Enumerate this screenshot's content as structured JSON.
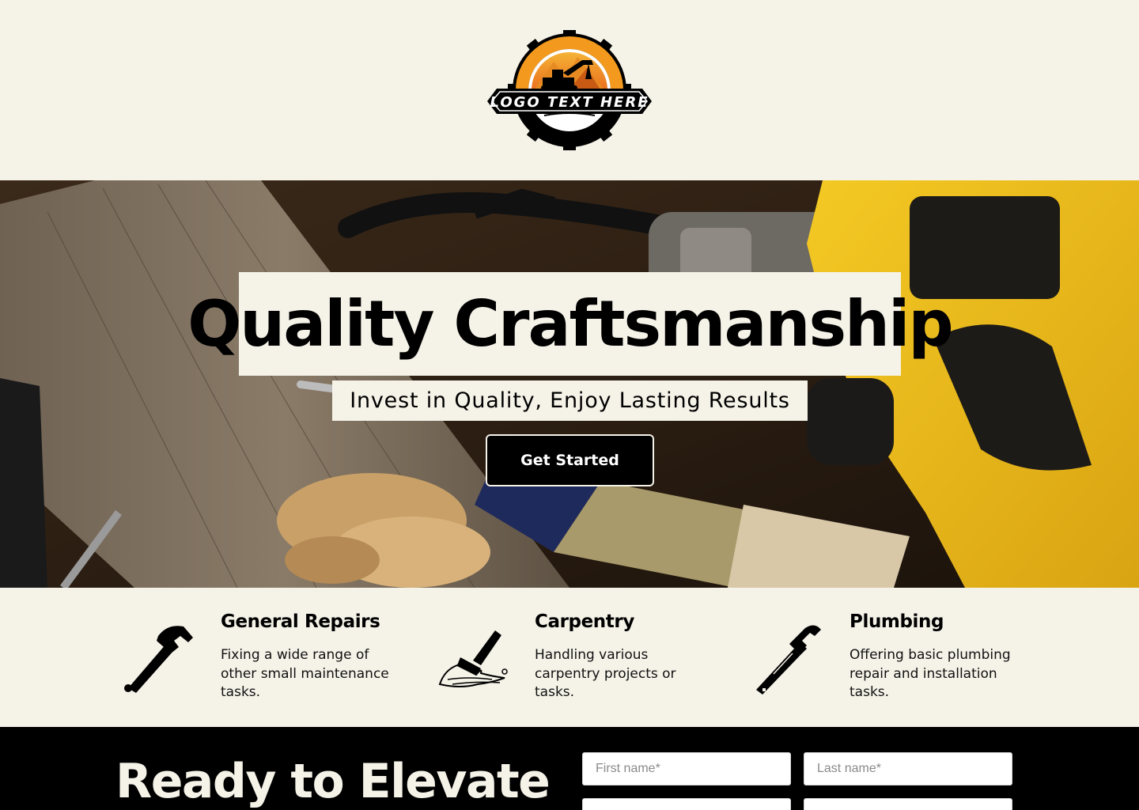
{
  "header": {
    "logo_text": "LOGO TEXT HERE"
  },
  "hero": {
    "title": "Quality Craftsmanship",
    "subtitle": "Invest in Quality, Enjoy Lasting Results",
    "cta_label": "Get Started"
  },
  "services": [
    {
      "icon": "hammer-icon",
      "title": "General Repairs",
      "description": "Fixing a wide range of other small maintenance tasks."
    },
    {
      "icon": "paintbrush-icon",
      "title": "Carpentry",
      "description": "Handling various carpentry projects or tasks."
    },
    {
      "icon": "pipe-wrench-icon",
      "title": "Plumbing",
      "description": "Offering basic plumbing repair and installation tasks."
    }
  ],
  "contact": {
    "heading": "Ready to Elevate",
    "first_name_placeholder": "First name*",
    "last_name_placeholder": "Last name*"
  },
  "colors": {
    "background": "#f5f2e8",
    "dark": "#000000",
    "accent_orange": "#f39a1e",
    "drill_yellow": "#f2c21b"
  }
}
